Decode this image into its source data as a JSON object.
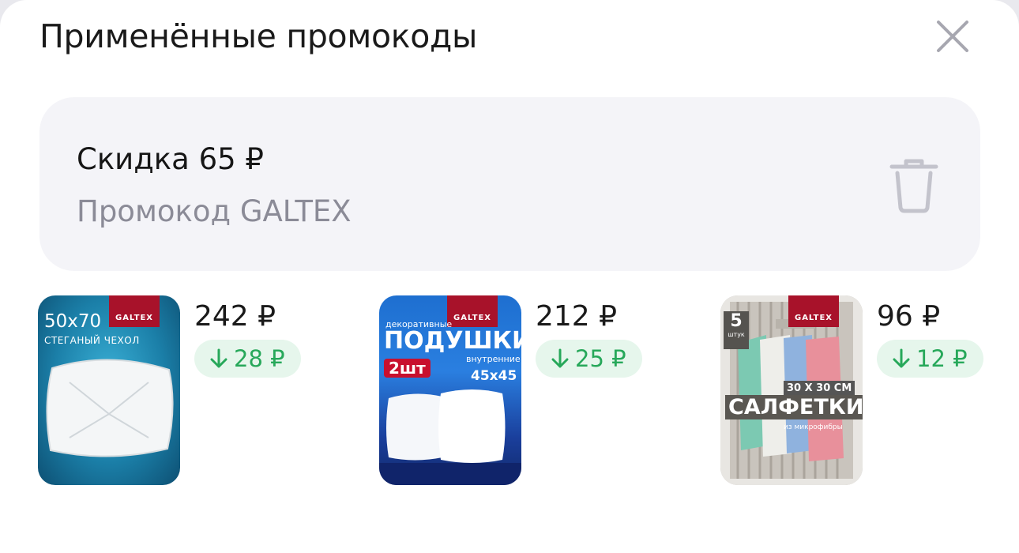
{
  "header": {
    "title": "Применённые промокоды"
  },
  "promo": {
    "title": "Скидка 65 ₽",
    "code": "Промокод GALTEX"
  },
  "products": [
    {
      "price": "242 ₽",
      "discount": "28 ₽",
      "image": {
        "brand": "GALTEX",
        "size": "50x70",
        "subtitle": "СТЕГАНЫЙ ЧЕХОЛ"
      }
    },
    {
      "price": "212 ₽",
      "discount": "25 ₽",
      "image": {
        "brand": "GALTEX",
        "tag": "декоративные",
        "title": "ПОДУШКИ",
        "subtitle": "внутренние",
        "count": "2шт",
        "size": "45x45"
      }
    },
    {
      "price": "96 ₽",
      "discount": "12 ₽",
      "image": {
        "brand": "GALTEX",
        "count": "5",
        "count_unit": "штук",
        "size": "30 X 30 СМ",
        "title": "САЛФЕТКИ",
        "subtitle": "из микрофибры"
      }
    }
  ],
  "colors": {
    "discount_text": "#27a85a",
    "discount_bg": "#e6f6ec",
    "promo_bg": "#f4f4f8",
    "brand_red": "#a8122a"
  },
  "icons": {
    "close": "close-icon",
    "delete": "trash-icon",
    "discount_arrow": "arrow-down-icon"
  }
}
